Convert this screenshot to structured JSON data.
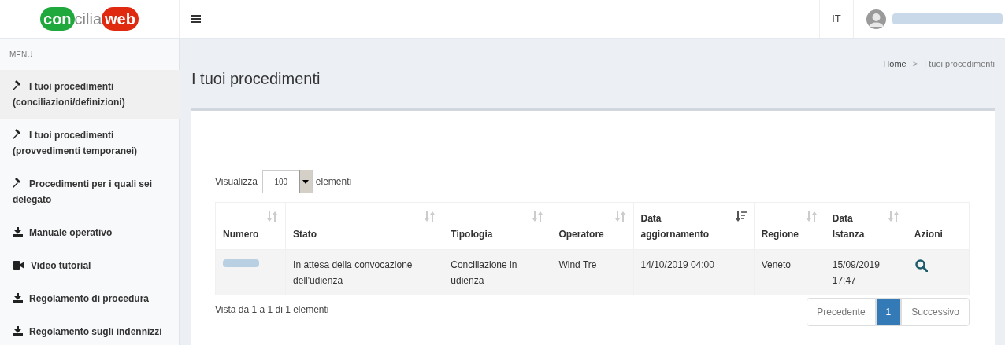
{
  "logo": {
    "parts": [
      "con",
      "cilia",
      "web"
    ]
  },
  "header": {
    "language": "IT"
  },
  "sidebar": {
    "heading": "MENU",
    "items": [
      {
        "label": "I tuoi procedimenti (conciliazioni/definizioni)",
        "kind": "gavel",
        "selected": true
      },
      {
        "label": "I tuoi procedimenti (provvedimenti temporanei)",
        "kind": "gavel",
        "selected": false
      },
      {
        "label": "Procedimenti per i quali sei delegato",
        "kind": "gavel",
        "selected": false
      },
      {
        "label": "Manuale operativo",
        "kind": "download",
        "selected": false
      },
      {
        "label": "Video tutorial",
        "kind": "video",
        "selected": false
      },
      {
        "label": "Regolamento di procedura",
        "kind": "download",
        "selected": false
      },
      {
        "label": "Regolamento sugli indennizzi",
        "kind": "download",
        "selected": false
      }
    ]
  },
  "page_title": "I tuoi procedimenti",
  "breadcrumb": {
    "separator": ">",
    "items": [
      "Home",
      "I tuoi procedimenti"
    ]
  },
  "length_control": {
    "prefix": "Visualizza",
    "value": "100",
    "suffix": "elementi"
  },
  "table": {
    "columns": [
      {
        "label": "Numero",
        "sortable": true,
        "sorted": false
      },
      {
        "label": "Stato",
        "sortable": true,
        "sorted": false
      },
      {
        "label": "Tipologia",
        "sortable": true,
        "sorted": false
      },
      {
        "label": "Operatore",
        "sortable": true,
        "sorted": false
      },
      {
        "label": "Data aggiornamento",
        "sortable": true,
        "sorted": true
      },
      {
        "label": "Regione",
        "sortable": true,
        "sorted": false
      },
      {
        "label": "Data Istanza",
        "sortable": true,
        "sorted": false
      },
      {
        "label": "Azioni",
        "sortable": false,
        "sorted": false
      }
    ],
    "rows": [
      {
        "cells": [
          "",
          "In attesa della convocazione dell'udienza",
          "Conciliazione in udienza",
          "Wind Tre",
          "14/10/2019 04:00",
          "Veneto",
          "15/09/2019 17:47"
        ]
      }
    ]
  },
  "info": "Vista da 1 a 1 di 1 elementi",
  "pagination": {
    "previous": "Precedente",
    "pages": [
      {
        "label": "1",
        "selected": true
      }
    ],
    "next": "Successivo"
  }
}
